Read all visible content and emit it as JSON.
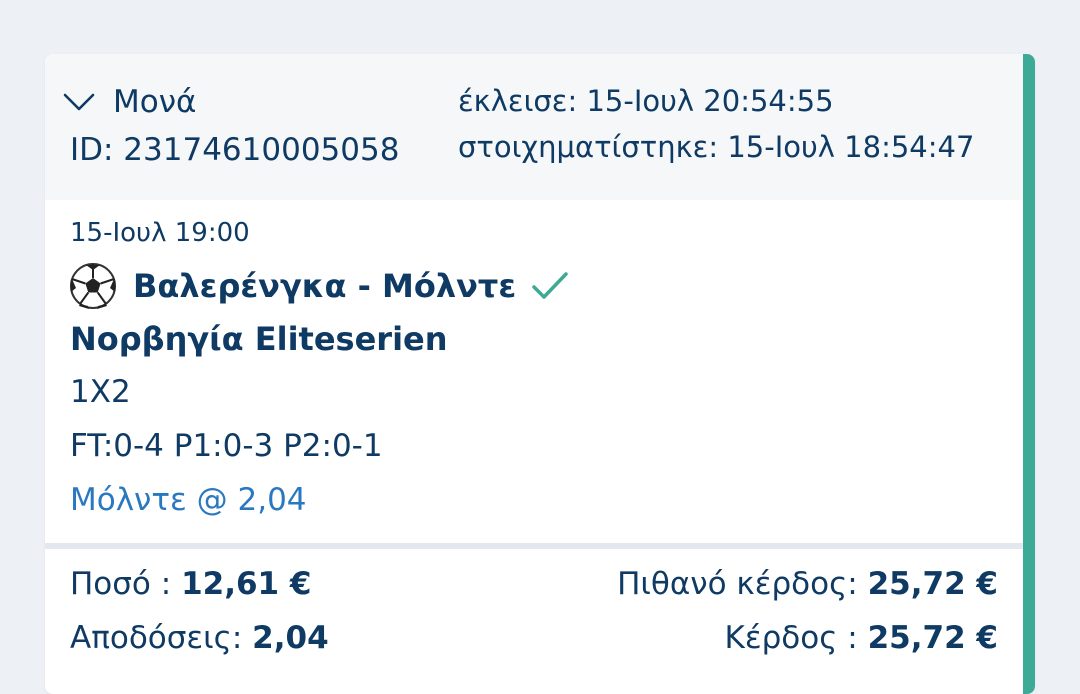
{
  "bet": {
    "type_label": "Μονά",
    "id_text": "ID: 23174610005058",
    "closed_label": "έκλεισε:",
    "closed_value": "15-Ιουλ 20:54:55",
    "placed_label": "στοιχηματίστηκε:",
    "placed_value": "15-Ιουλ 18:54:47",
    "status": "won"
  },
  "event": {
    "datetime": "15-Ιουλ 19:00",
    "sport_icon": "soccer-ball-icon",
    "match": "Βαλερένγκα - Μόλντε",
    "result_icon": "check-icon",
    "league": "Νορβηγία Eliteserien",
    "market": "1X2",
    "score": "FT:0-4 P1:0-3 P2:0-1",
    "selection": "Μόλντε @ 2,04"
  },
  "summary": {
    "stake_label": "Ποσό :",
    "stake_value": "12,61 €",
    "odds_label": "Αποδόσεις:",
    "odds_value": "2,04",
    "potential_label": "Πιθανό κέρδος:",
    "potential_value": "25,72 €",
    "profit_label": "Κέρδος :",
    "profit_value": "25,72 €"
  },
  "colors": {
    "background": "#edf1f6",
    "primary_text": "#0f3a63",
    "link": "#2a79c0",
    "success": "#3daa97",
    "header_bg": "#f5f7f9"
  }
}
